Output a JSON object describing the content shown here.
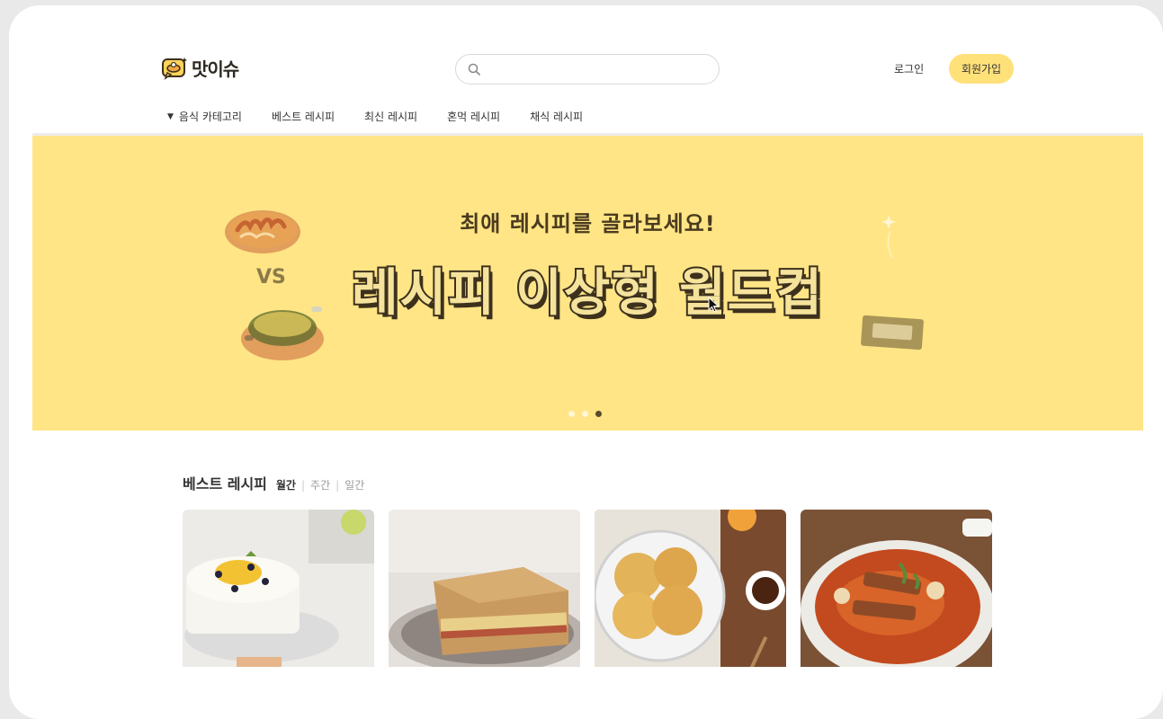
{
  "header": {
    "logo_text": "맛이슈",
    "search_placeholder": "",
    "login_label": "로그인",
    "signup_label": "회원가입"
  },
  "nav": {
    "items": [
      {
        "label": "음식 카테고리"
      },
      {
        "label": "베스트 레시피"
      },
      {
        "label": "최신 레시피"
      },
      {
        "label": "혼먹 레시피"
      },
      {
        "label": "채식 레시피"
      }
    ]
  },
  "banner": {
    "subtitle": "최애 레시피를 골라보세요!",
    "title": "레시피 이상형 월드컵",
    "vs_text": "VS",
    "active_slide": 3,
    "slide_count": 3
  },
  "best": {
    "title": "베스트 레시피",
    "tabs": [
      "월간",
      "주간",
      "일간"
    ],
    "selected_tab": "월간"
  },
  "colors": {
    "accent": "#ffe17a",
    "banner_bg": "#ffe585",
    "text_dark": "#3d311d"
  }
}
